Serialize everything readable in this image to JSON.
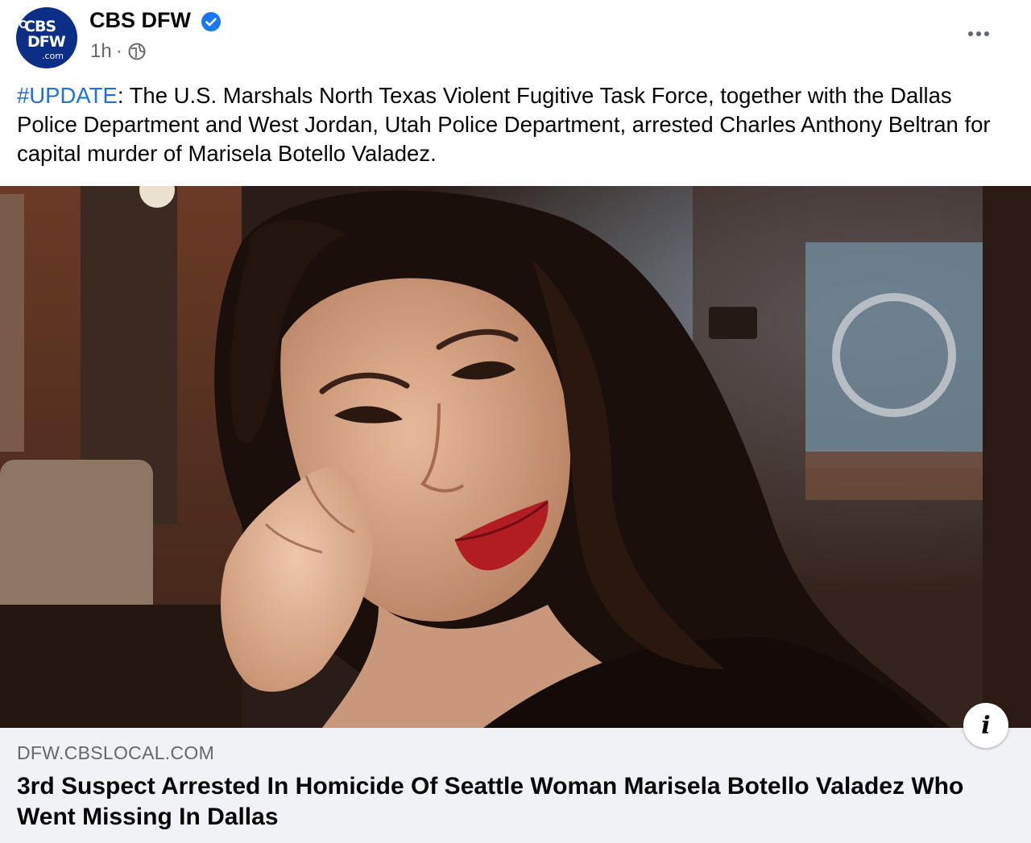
{
  "post": {
    "page_name": "CBS DFW",
    "verified": true,
    "timestamp": "1h",
    "separator": "·",
    "audience_icon": "globe-icon",
    "more_icon": "more-options-icon",
    "avatar": {
      "line1": "CBS",
      "line2": "DFW",
      "line3": ".com"
    },
    "message": {
      "hashtag": "#UPDATE",
      "text": ": The U.S. Marshals North Texas Violent Fugitive Task Force, together with the Dallas Police Department and West Jordan, Utah Police Department, arrested Charles Anthony Beltran for capital murder of Marisela Botello Valadez."
    }
  },
  "link_preview": {
    "info_icon_label": "i",
    "domain": "DFW.CBSLOCAL.COM",
    "title": "3rd Suspect Arrested In Homicide Of Seattle Woman Marisela Botello Valadez Who Went Missing In Dallas"
  },
  "colors": {
    "text": "#050505",
    "secondary_text": "#65676b",
    "hashtag": "#216fdb",
    "verified": "#1877f2",
    "link_background": "#f0f2f5",
    "avatar_background": "#0b2f86"
  }
}
